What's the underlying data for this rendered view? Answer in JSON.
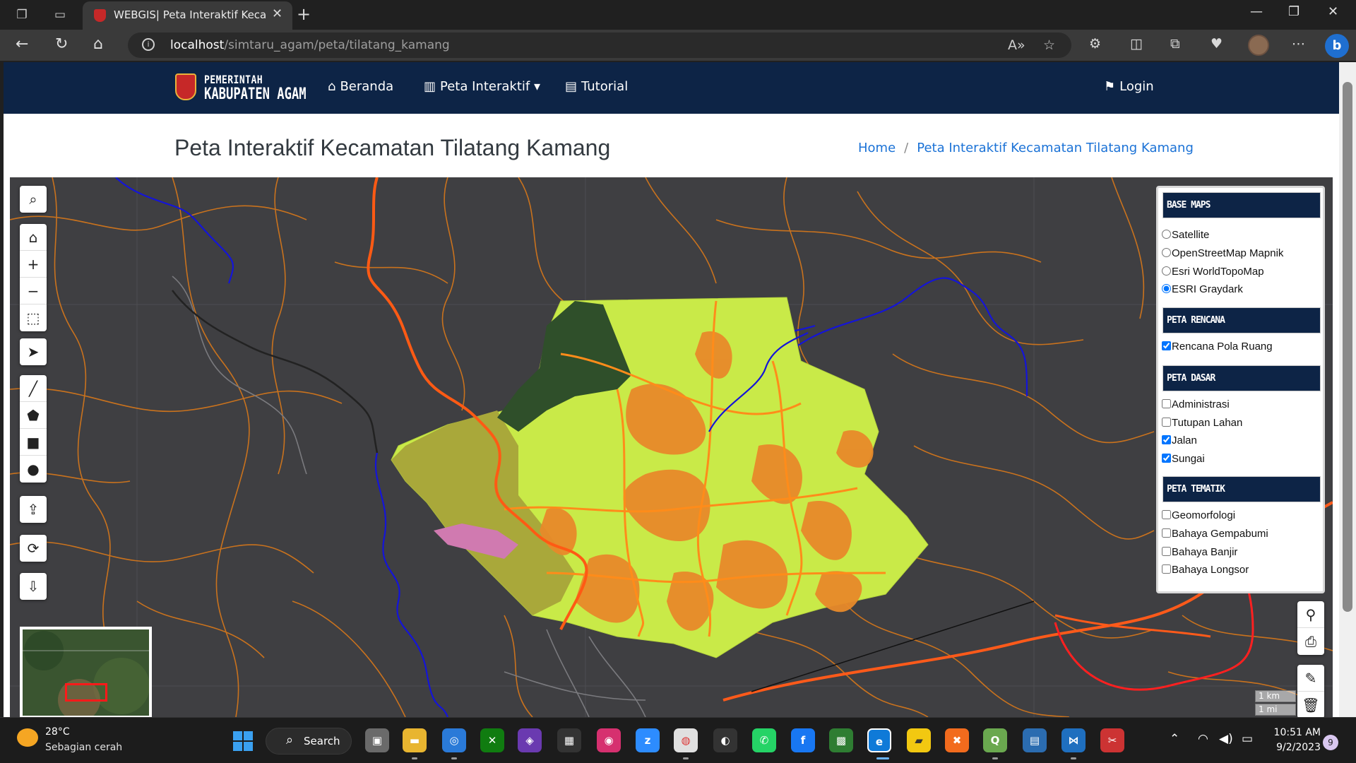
{
  "browser": {
    "tab_title": "WEBGIS| Peta Interaktif Kecamatan Tilatang Kamang",
    "url_host": "localhost",
    "url_path": "/simtaru_agam/peta/tilatang_kamang",
    "read_aloud_icon": "A»"
  },
  "site": {
    "logo_line1": "PEMERINTAH",
    "logo_line2": "KABUPATEN AGAM",
    "nav": {
      "beranda": "Beranda",
      "peta_interaktif": "Peta Interaktif",
      "tutorial": "Tutorial",
      "login": "Login"
    }
  },
  "header": {
    "page_title": "Peta Interaktif Kecamatan Tilatang Kamang",
    "breadcrumb_home": "Home",
    "breadcrumb_sep": "/",
    "breadcrumb_current": "Peta Interaktif Kecamatan Tilatang Kamang"
  },
  "layers": {
    "base_maps_title": "BASE MAPS",
    "base_maps": [
      {
        "label": "Satellite",
        "checked": false
      },
      {
        "label": "OpenStreetMap Mapnik",
        "checked": false
      },
      {
        "label": "Esri WorldTopoMap",
        "checked": false
      },
      {
        "label": "ESRI Graydark",
        "checked": true
      }
    ],
    "rencana_title": "PETA RENCANA",
    "rencana": [
      {
        "label": "Rencana Pola Ruang",
        "checked": true
      }
    ],
    "dasar_title": "PETA DASAR",
    "dasar": [
      {
        "label": "Administrasi",
        "checked": false
      },
      {
        "label": "Tutupan Lahan",
        "checked": false
      },
      {
        "label": "Jalan",
        "checked": true
      },
      {
        "label": "Sungai",
        "checked": true
      }
    ],
    "tematik_title": "PETA TEMATIK",
    "tematik": [
      {
        "label": "Geomorfologi",
        "checked": false
      },
      {
        "label": "Bahaya Gempabumi",
        "checked": false
      },
      {
        "label": "Bahaya Banjir",
        "checked": false
      },
      {
        "label": "Bahaya Longsor",
        "checked": false
      }
    ]
  },
  "map": {
    "scale_km": "1 km",
    "scale_mi": "1 mi",
    "colors": {
      "background": "#3f3f42",
      "roads": "#d9781a",
      "major_road": "#ff5a1a",
      "rivers": "#1414d8",
      "boundary": "#ff5a14",
      "zone_yellow": "#c9ea48",
      "zone_orange": "#e88a2a",
      "forest": "#2f4f2a",
      "olive": "#a9a83a",
      "pink": "#d07ab0"
    }
  },
  "taskbar": {
    "temperature": "28°C",
    "weather": "Sebagian cerah",
    "search_label": "Search",
    "time": "10:51 AM",
    "date": "9/2/2023",
    "notifications": "9"
  }
}
